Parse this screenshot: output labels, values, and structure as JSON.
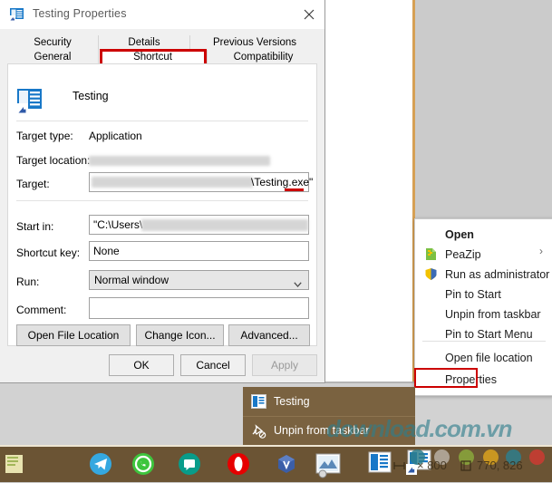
{
  "desktop": {
    "background_color": "#c9c9c9",
    "accent_border_color": "#d6a055"
  },
  "dialog": {
    "title": "Testing Properties",
    "title_icon": "shortcut-properties-icon",
    "close_icon": "close-icon",
    "tabs_row1": [
      {
        "label": "Security",
        "selected": false
      },
      {
        "label": "Details",
        "selected": false
      },
      {
        "label": "Previous Versions",
        "selected": false
      }
    ],
    "tabs_row2": [
      {
        "label": "General",
        "selected": false
      },
      {
        "label": "Shortcut",
        "selected": true
      },
      {
        "label": "Compatibility",
        "selected": false
      }
    ],
    "highlight_color": "#cc0000",
    "app_name": "Testing",
    "app_icon": "shortcut-file-icon",
    "fields": {
      "target_type_label": "Target type:",
      "target_type_value": "Application",
      "target_location_label": "Target location:",
      "target_location_value": "",
      "target_label": "Target:",
      "target_value_suffix": "\\Testing.exe\"",
      "start_in_label": "Start in:",
      "start_in_value_prefix": "\"C:\\Users\\",
      "shortcut_key_label": "Shortcut key:",
      "shortcut_key_value": "None",
      "run_label": "Run:",
      "run_value": "Normal window",
      "comment_label": "Comment:",
      "comment_value": ""
    },
    "panel_buttons": [
      {
        "label": "Open File Location"
      },
      {
        "label": "Change Icon..."
      },
      {
        "label": "Advanced..."
      }
    ],
    "dialog_buttons": [
      {
        "label": "OK",
        "disabled": false
      },
      {
        "label": "Cancel",
        "disabled": false
      },
      {
        "label": "Apply",
        "disabled": true
      }
    ]
  },
  "context_menu": {
    "items": [
      {
        "label": "Open",
        "bold": true,
        "icon": "",
        "submenu": false
      },
      {
        "label": "PeaZip",
        "bold": false,
        "icon": "peazip-icon",
        "submenu": true
      },
      {
        "label": "Run as administrator",
        "bold": false,
        "icon": "shield-icon",
        "submenu": false
      },
      {
        "label": "Pin to Start",
        "bold": false,
        "icon": "",
        "submenu": false
      },
      {
        "label": "Unpin from taskbar",
        "bold": false,
        "icon": "",
        "submenu": false
      },
      {
        "label": "Pin to Start Menu",
        "bold": false,
        "icon": "",
        "submenu": false
      },
      {
        "label": "Open file location",
        "bold": false,
        "icon": "",
        "submenu": false
      },
      {
        "label": "Properties",
        "bold": false,
        "icon": "",
        "submenu": false
      }
    ],
    "submenu_chevron": "›",
    "highlighted_item": "Properties"
  },
  "jump_list": {
    "background_color": "#7a6240",
    "items": [
      {
        "label": "Testing",
        "icon": "app-window-icon"
      },
      {
        "label": "Unpin from taskbar",
        "icon": "unpin-icon"
      }
    ]
  },
  "watermark": {
    "text": "download.com.vn",
    "color": "#2e7e8c"
  },
  "taskbar": {
    "background_color": "#6b5434",
    "icons": [
      {
        "name": "sticky-note-green-icon",
        "color": "#e8e3b0"
      },
      {
        "name": "telegram-icon",
        "color": "#35a8e0"
      },
      {
        "name": "whatsapp-icon",
        "color": "#3ec53e"
      },
      {
        "name": "messaging-icon",
        "color": "#089c8a"
      },
      {
        "name": "opera-icon",
        "color": "#e60000"
      },
      {
        "name": "virtualbox-icon",
        "color": "#3b5ea8"
      },
      {
        "name": "notepad-icon",
        "color": "#f0e6b8"
      },
      {
        "name": "paint-icon",
        "color": "#dfe9f2"
      },
      {
        "name": "app-window-icon",
        "color": "#1878c8"
      },
      {
        "name": "shortcut-properties-icon",
        "color": "#1878c8"
      }
    ],
    "dots": [
      "#2e7e8c",
      "#b8b0a4",
      "#8aa83c",
      "#d9a21e",
      "#2e7e8c",
      "#cc3b33"
    ]
  },
  "overlay_ruler": {
    "size_text": "× 800",
    "coords_text": "770, 826",
    "size_icon": "measure-icon",
    "coords_icon": "coords-icon"
  }
}
